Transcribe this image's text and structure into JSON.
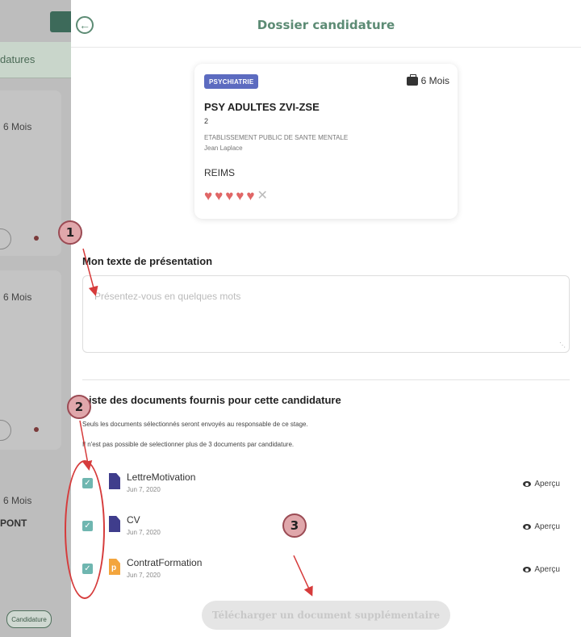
{
  "background": {
    "tab_label": "datures",
    "card1_duration": "6 Mois",
    "card2_duration": "6 Mois",
    "card3_duration": "6 Mois",
    "card3_name": "PONT",
    "pill_label": "Candidature"
  },
  "header": {
    "title": "Dossier candidature"
  },
  "offer": {
    "badge": "PSYCHIATRIE",
    "duration": "6 Mois",
    "title": "PSY ADULTES ZVI-ZSE",
    "number": "2",
    "establishment": "ETABLISSEMENT PUBLIC DE SANTE MENTALE",
    "person": "Jean Laplace",
    "city": "REIMS",
    "rating": {
      "hearts": 5,
      "max": 6
    }
  },
  "presentation": {
    "label": "Mon texte de présentation",
    "placeholder": "Présentez-vous en quelques mots"
  },
  "documents": {
    "label": "Liste des documents fournis pour cette candidature",
    "hint1": "Seuls les documents sélectionnés seront envoyés au responsable de ce stage.",
    "hint2": "Il n'est pas possible de selectionner plus de 3 documents par candidature.",
    "preview_label": "Aperçu",
    "items": [
      {
        "name": "LettreMotivation",
        "date": "Jun 7, 2020",
        "checked": true,
        "type": "doc"
      },
      {
        "name": "CV",
        "date": "Jun 7, 2020",
        "checked": true,
        "type": "doc"
      },
      {
        "name": "ContratFormation",
        "date": "Jun 7, 2020",
        "checked": true,
        "type": "pdf"
      }
    ],
    "upload_label": "Télécharger un document supplémentaire"
  },
  "annotations": {
    "marker1": "1",
    "marker2": "2",
    "marker3": "3",
    "color": "#d63b3b"
  }
}
